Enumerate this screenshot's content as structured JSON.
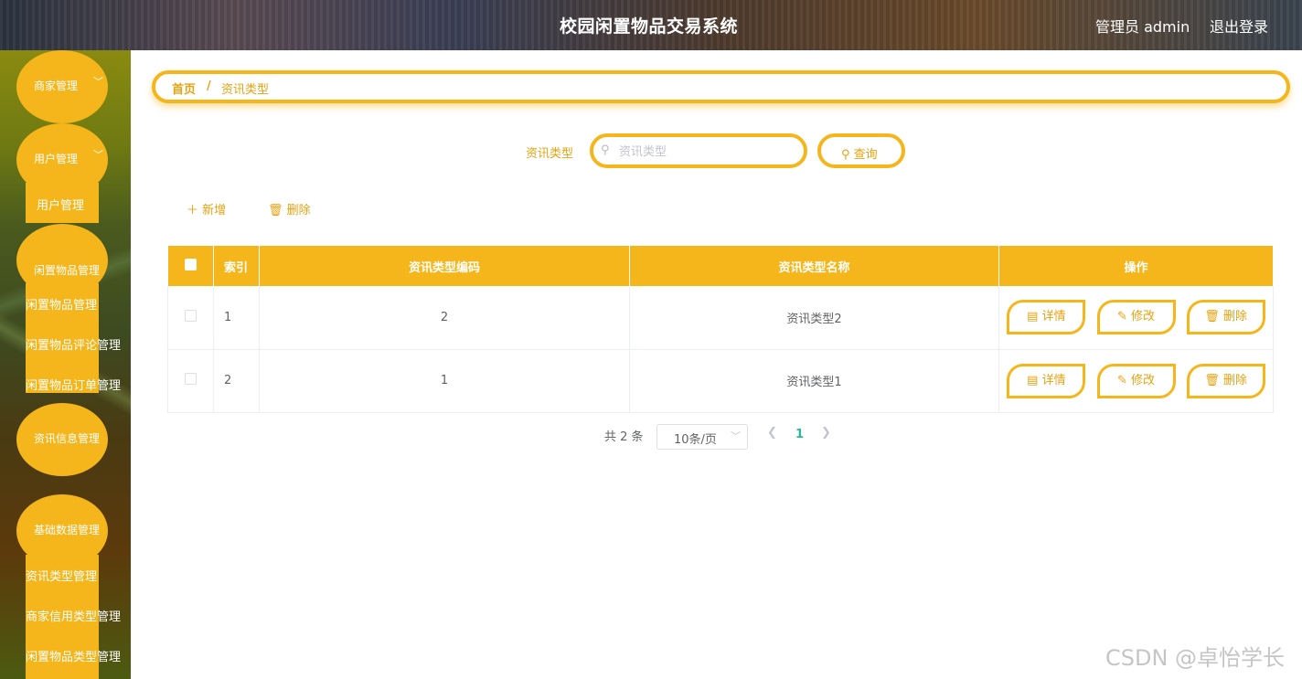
{
  "header": {
    "title": "校园闲置物品交易系统",
    "admin": "管理员 admin",
    "logout": "退出登录"
  },
  "sidebar": {
    "menus": [
      {
        "label": "商家管理",
        "chevron": "﹀"
      },
      {
        "label": "用户管理",
        "chevron": "﹀"
      },
      {
        "label": "闲置物品管理"
      },
      {
        "label": "资讯信息管理"
      },
      {
        "label": "基础数据管理"
      }
    ],
    "subitems": {
      "user": "用户管理",
      "goods": "闲置物品管理",
      "goods_comment": "闲置物品评论管理",
      "goods_order": "闲置物品订单管理",
      "news_type": "资讯类型管理",
      "merchant_credit": "商家信用类型管理",
      "goods_type": "闲置物品类型管理"
    }
  },
  "breadcrumb": {
    "home": "首页",
    "separator": "/",
    "current": "资讯类型"
  },
  "search": {
    "label": "资讯类型",
    "placeholder": "资讯类型",
    "button": "查询"
  },
  "actions": {
    "add": "新增",
    "delete": "删除"
  },
  "table": {
    "headers": {
      "index": "索引",
      "code": "资讯类型编码",
      "name": "资讯类型名称",
      "ops": "操作"
    },
    "rows": [
      {
        "index": "1",
        "code": "2",
        "name": "资讯类型2"
      },
      {
        "index": "2",
        "code": "1",
        "name": "资讯类型1"
      }
    ],
    "ops": {
      "detail": "详情",
      "edit": "修改",
      "delete": "删除"
    }
  },
  "pagination": {
    "total": "共 2 条",
    "page_size": "10条/页",
    "current_page": "1"
  },
  "watermark": "CSDN @卓怡学长",
  "colors": {
    "accent": "#f5b61c",
    "accent_text": "#e8a20f",
    "active_page": "#26b99a"
  }
}
